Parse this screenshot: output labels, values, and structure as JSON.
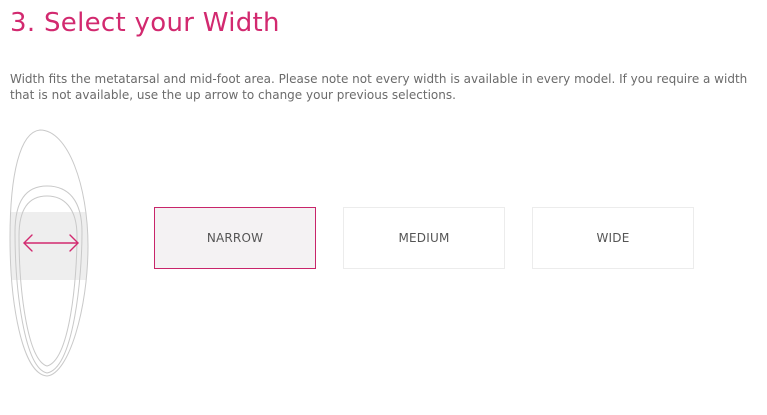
{
  "heading": "3. Select your Width",
  "description": "Width fits the metatarsal and mid-foot area. Please note not every width is available in every model. If you require a width that is not available, use the up arrow to change your previous selections.",
  "width_options": [
    {
      "label": "NARROW",
      "selected": true
    },
    {
      "label": "MEDIUM",
      "selected": false
    },
    {
      "label": "WIDE",
      "selected": false
    }
  ],
  "foot_graphic": {
    "icon": "foot-width-arrow-icon"
  },
  "colors": {
    "accent": "#d2296f",
    "selected_border": "#c8256a",
    "selected_bg": "#f4f2f3",
    "text": "#6b6b6b",
    "option_text": "#555555",
    "outline": "#c9c9c9",
    "highlight_band": "#eeeeee"
  }
}
